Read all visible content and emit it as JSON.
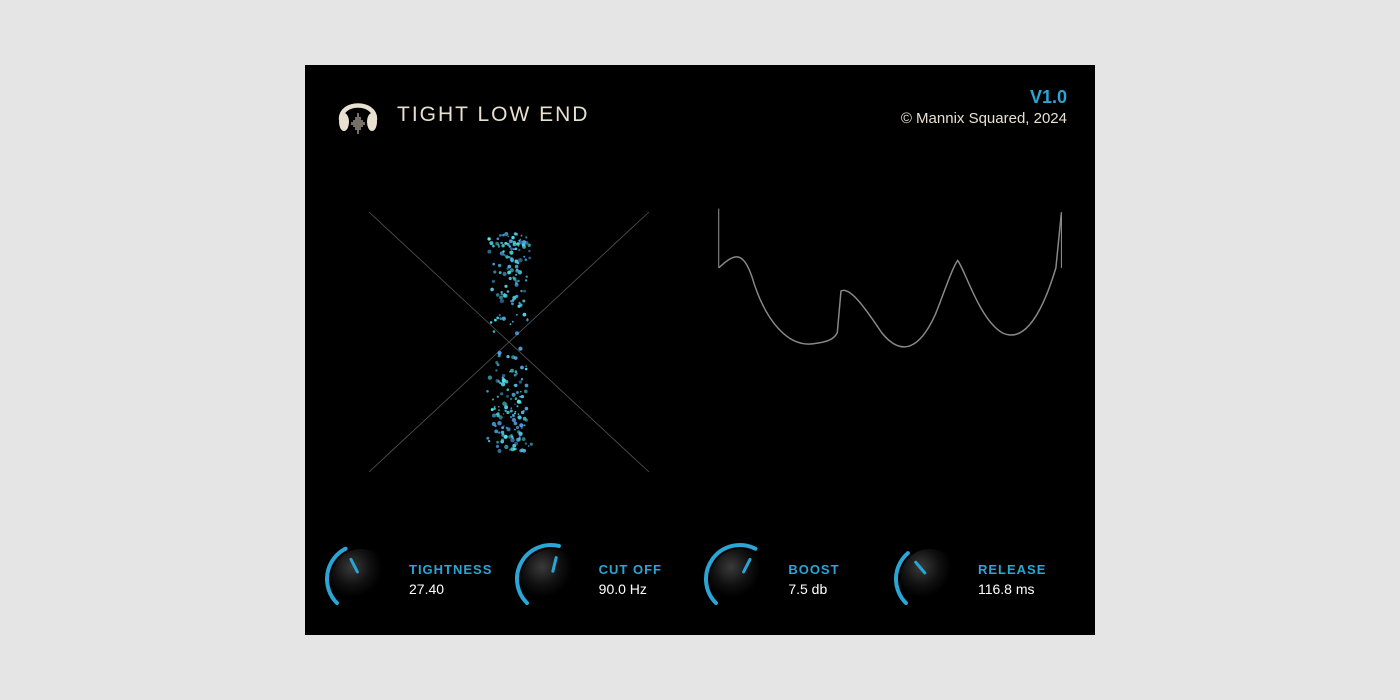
{
  "header": {
    "title": "TIGHT LOW END",
    "version": "V1.0",
    "copyright": "© Mannix Squared, 2024"
  },
  "knobs": [
    {
      "label": "TIGHTNESS",
      "value": "27.40",
      "angle": 40
    },
    {
      "label": "CUT OFF",
      "value": "90.0 Hz",
      "angle": 55
    },
    {
      "label": "BOOST",
      "value": "7.5 db",
      "angle": 60
    },
    {
      "label": "RELEASE",
      "value": "116.8 ms",
      "angle": 35
    }
  ],
  "colors": {
    "accent": "#2aa6d6",
    "cream": "#e8e0d0"
  }
}
